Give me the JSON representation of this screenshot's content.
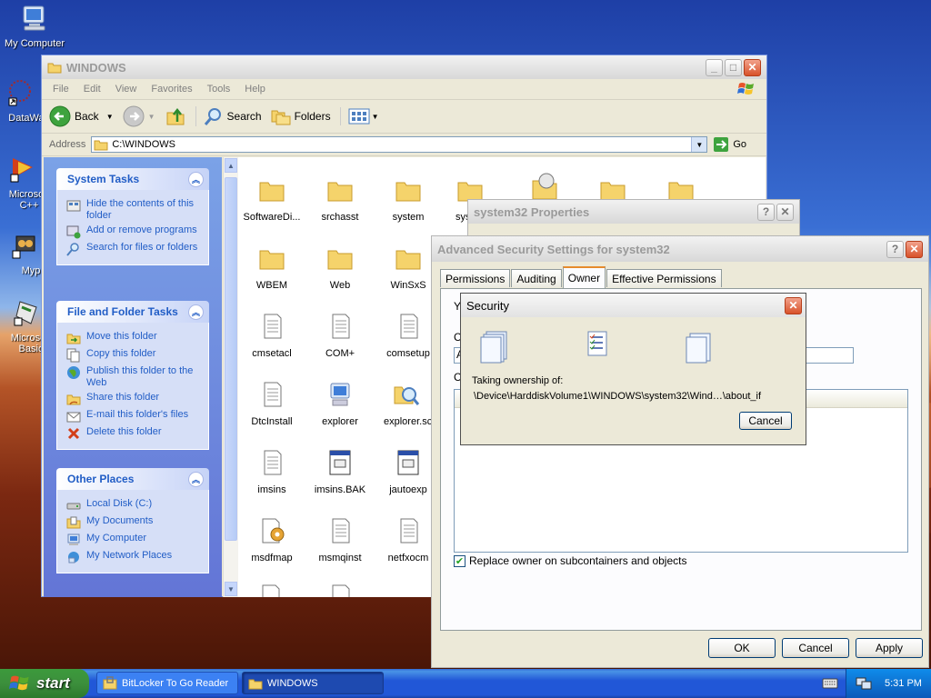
{
  "desktop": {
    "icons": [
      {
        "label": "My Computer"
      },
      {
        "label": "DataWag"
      },
      {
        "label": "Microsoft C++"
      },
      {
        "label": "Myp"
      },
      {
        "label": "Microsoft Basic"
      }
    ]
  },
  "explorer": {
    "title": "WINDOWS",
    "menu": [
      "File",
      "Edit",
      "View",
      "Favorites",
      "Tools",
      "Help"
    ],
    "toolbar": {
      "back": "Back",
      "search": "Search",
      "folders": "Folders"
    },
    "address": {
      "label": "Address",
      "value": "C:\\WINDOWS",
      "go": "Go"
    },
    "system_tasks": {
      "title": "System Tasks",
      "items": [
        "Hide the contents of this folder",
        "Add or remove programs",
        "Search for files or folders"
      ]
    },
    "file_folder_tasks": {
      "title": "File and Folder Tasks",
      "items": [
        "Move this folder",
        "Copy this folder",
        "Publish this folder to the Web",
        "Share this folder",
        "E-mail this folder's files",
        "Delete this folder"
      ]
    },
    "other_places": {
      "title": "Other Places",
      "items": [
        "Local Disk (C:)",
        "My Documents",
        "My Computer",
        "My Network Places"
      ]
    },
    "files": [
      {
        "name": "SoftwareDi...",
        "type": "folder"
      },
      {
        "name": "srchasst",
        "type": "folder"
      },
      {
        "name": "system",
        "type": "folder"
      },
      {
        "name": "sys",
        "type": "folder"
      },
      {
        "name": "",
        "type": "folder-special"
      },
      {
        "name": "",
        "type": "folder"
      },
      {
        "name": "",
        "type": "folder"
      },
      {
        "name": "WBEM",
        "type": "folder"
      },
      {
        "name": "Web",
        "type": "folder"
      },
      {
        "name": "WinSxS",
        "type": "folder"
      },
      {
        "name": "cmsetacl",
        "type": "text"
      },
      {
        "name": "COM+",
        "type": "text"
      },
      {
        "name": "comsetup",
        "type": "text"
      },
      {
        "name": "DtcInstall",
        "type": "text"
      },
      {
        "name": "explorer",
        "type": "computer"
      },
      {
        "name": "explorer.scf",
        "type": "scf"
      },
      {
        "name": "imsins",
        "type": "text"
      },
      {
        "name": "imsins.BAK",
        "type": "app"
      },
      {
        "name": "jautoexp",
        "type": "app"
      },
      {
        "name": "msdfmap",
        "type": "settings"
      },
      {
        "name": "msmqinst",
        "type": "text"
      },
      {
        "name": "netfxocm",
        "type": "text"
      }
    ]
  },
  "props": {
    "title": "system32 Properties"
  },
  "advanced": {
    "title": "Advanced Security Settings for system32",
    "tabs": [
      "Permissions",
      "Auditing",
      "Owner",
      "Effective Permissions"
    ],
    "active_tab": "Owner",
    "label_y": "Y",
    "label_c": "C",
    "label_c2": "C",
    "field_a": "A",
    "checkbox_label": "Replace owner on subcontainers and objects",
    "checkbox_checked": true,
    "ok": "OK",
    "cancel": "Cancel",
    "apply": "Apply"
  },
  "security": {
    "title": "Security",
    "message": "Taking ownership of:",
    "path": "\\Device\\HarddiskVolume1\\WINDOWS\\system32\\Wind…\\about_if",
    "cancel": "Cancel"
  },
  "taskbar": {
    "start": "start",
    "items": [
      "BitLocker To Go Reader",
      "WINDOWS"
    ],
    "time": "5:31 PM"
  },
  "colors": {
    "link_blue": "#215dc6",
    "xp_blue": "#2157d7",
    "start_green": "#3c8f3c"
  }
}
